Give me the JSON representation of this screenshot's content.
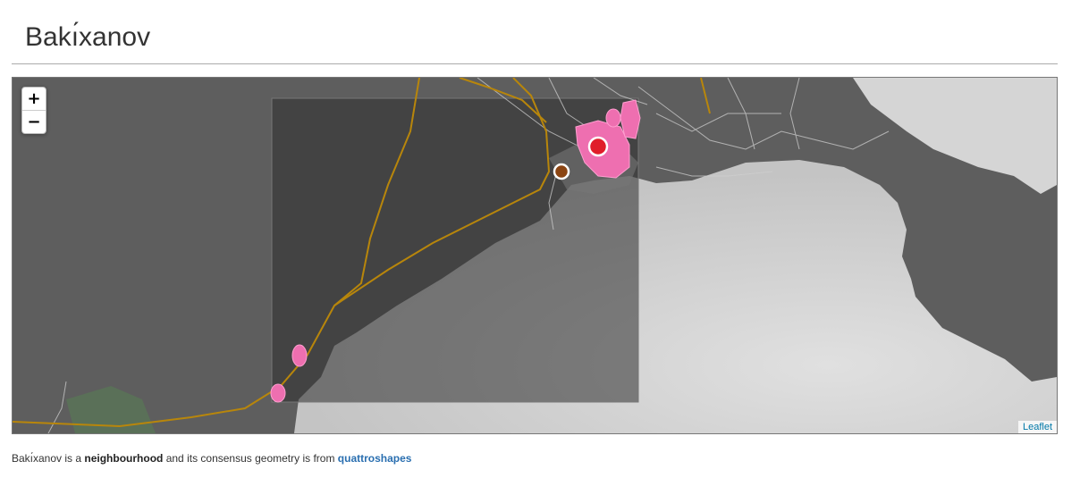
{
  "page": {
    "title": "Bakı́xanov"
  },
  "map": {
    "zoom_in_label": "+",
    "zoom_out_label": "−",
    "attribution": "Leaflet",
    "colors": {
      "land": "#626262",
      "water": "#d2d2d2",
      "bbox_fill": "#3a3a3a",
      "roads_major": "#b8860b",
      "roads_minor": "#cfcfcf",
      "geometry_pink": "#ee6fb0",
      "centroid_red": "#e01e2a",
      "marker_brown": "#8b4513",
      "park_green": "#5a7058"
    }
  },
  "caption": {
    "name": "Bakı́xanov",
    "text_a": " is a ",
    "placetype": "neighbourhood",
    "text_b": " and its consensus geometry is from ",
    "source": "quattroshapes"
  }
}
